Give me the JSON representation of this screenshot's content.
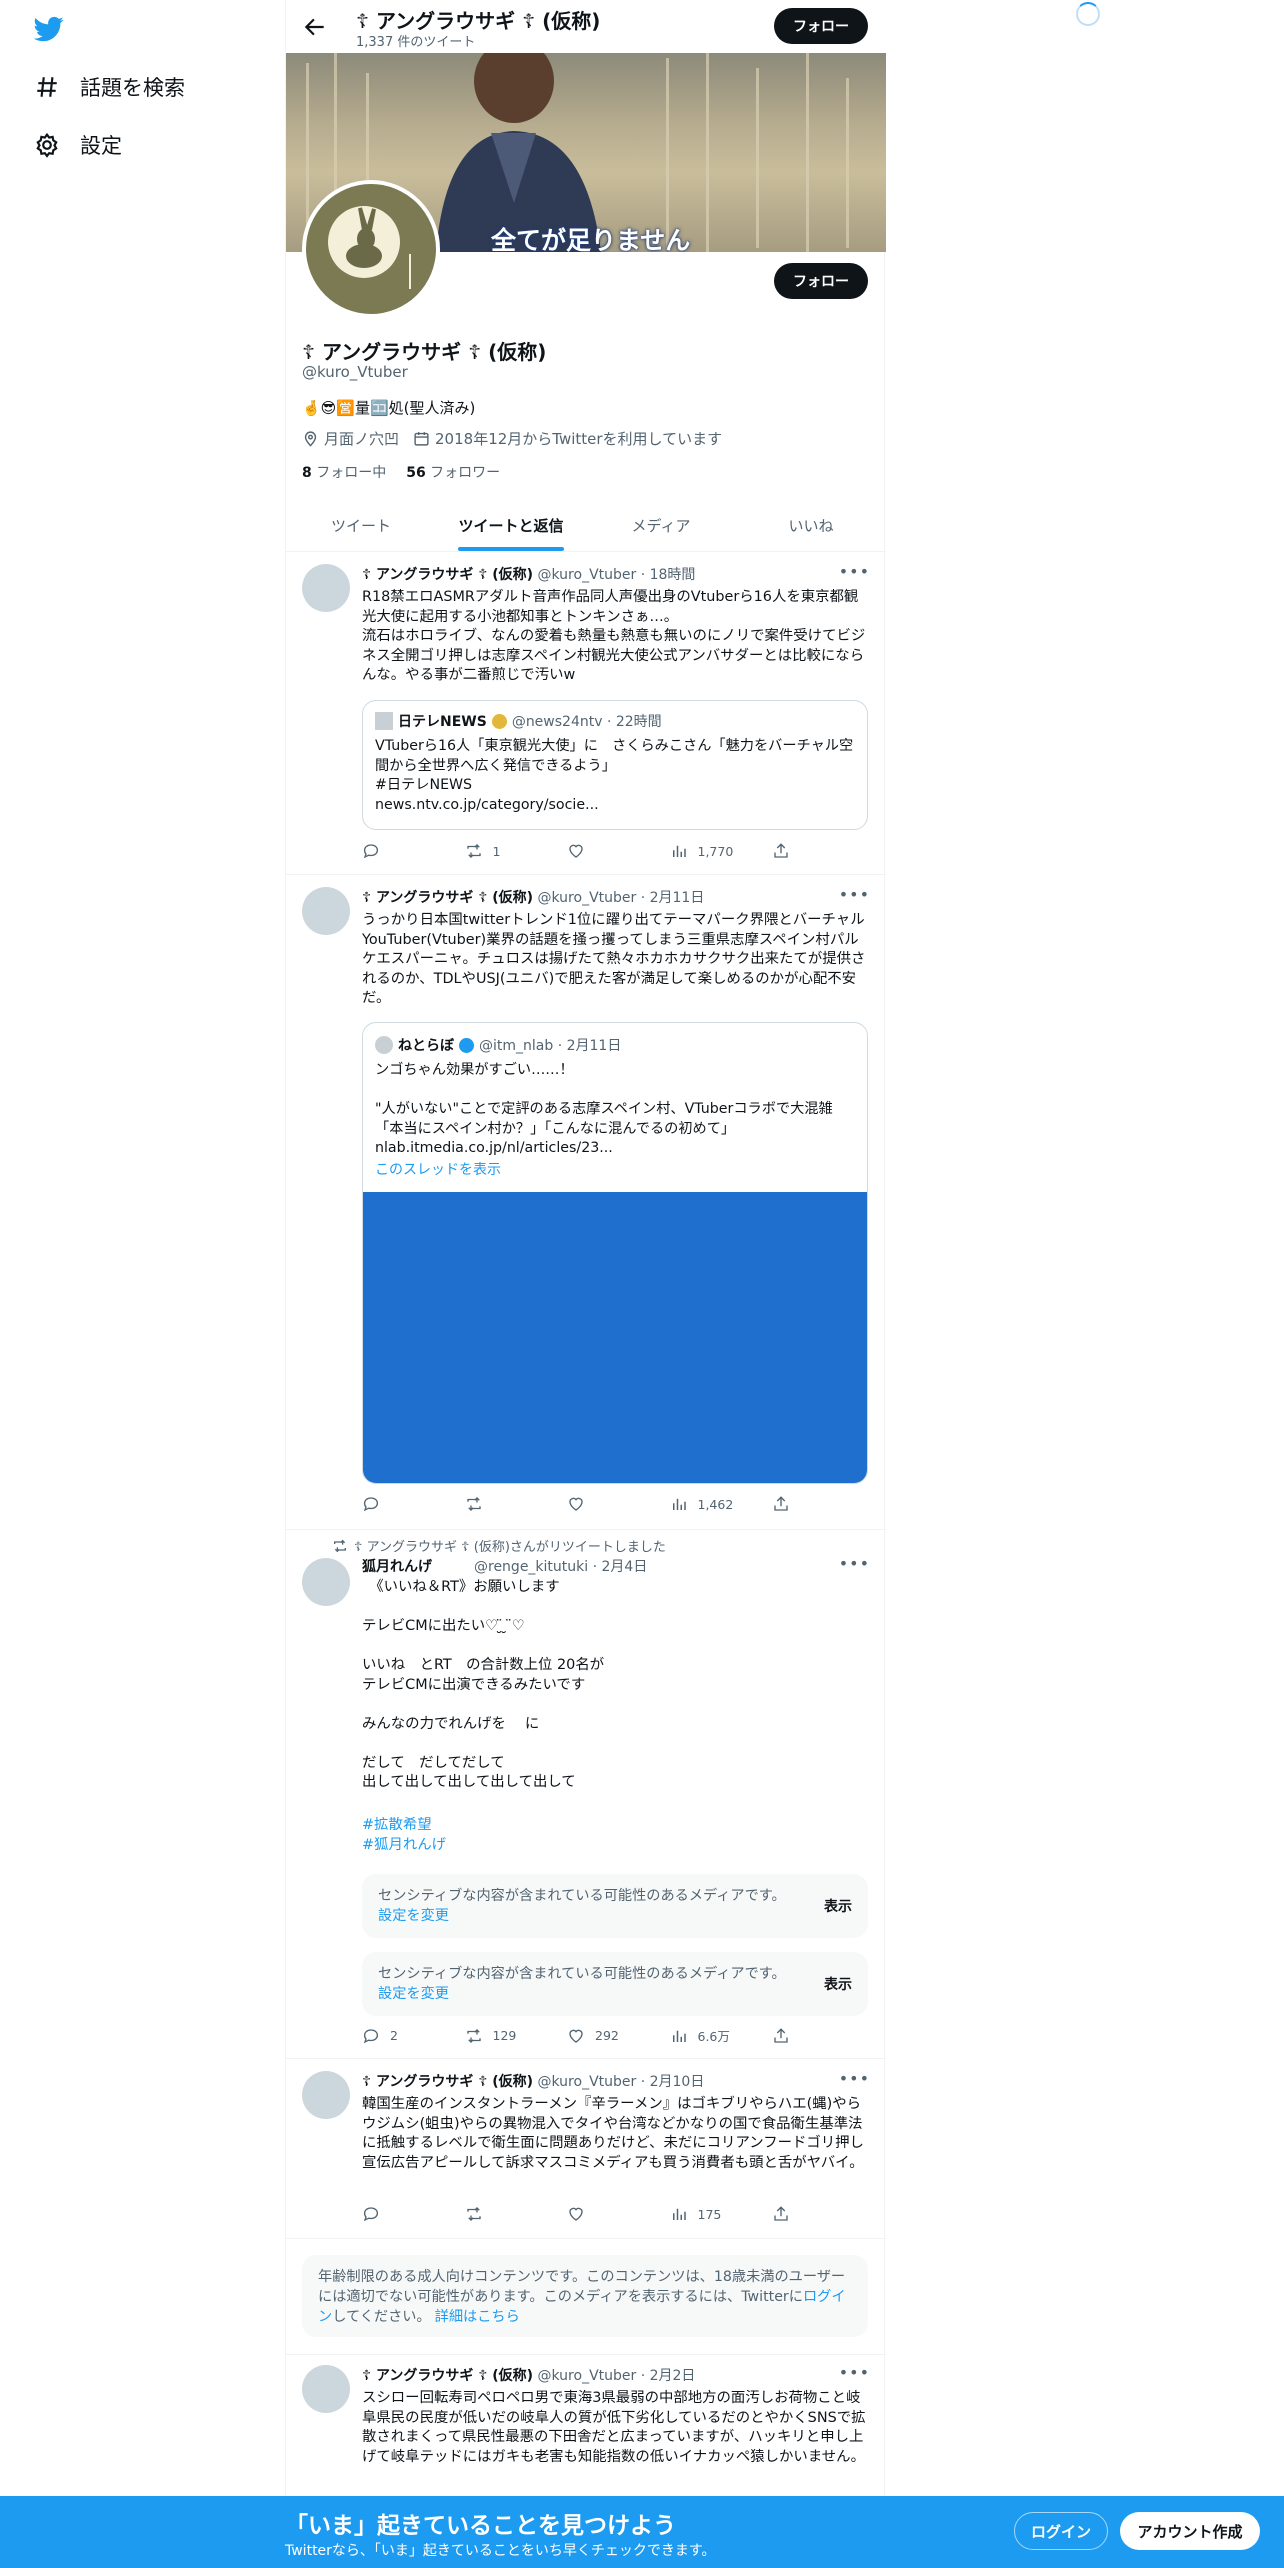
{
  "nav": {
    "explore": "話題を検索",
    "settings": "設定"
  },
  "profile": {
    "name": "☦ アングラウサギ ☦ (仮称)",
    "tweet_count": "1,337 件のツイート",
    "follow": "フォロー",
    "banner_caption": "全てが足りません",
    "handle": "@kuro_Vtuber",
    "bio": "🤞😎🈺量🈁処(聖人済み)",
    "location": "月面ノ穴凹",
    "joined": "2018年12月からTwitterを利用しています",
    "following_count": "8",
    "following_label": "フォロー中",
    "followers_count": "56",
    "followers_label": "フォロワー"
  },
  "tabs": [
    "ツイート",
    "ツイートと返信",
    "メディア",
    "いいね"
  ],
  "tweets": [
    {
      "name": "☦ アングラウサギ ☦ (仮称)",
      "handle": "@kuro_Vtuber · 18時間",
      "text": "R18禁エロASMRアダルト音声作品同人声優出身のVtuberら16人を東京都観光大使に起用する小池都知事とトンキンさぁ…。\n流石はホロライブ、なんの愛着も熱量も熱意も無いのにノリで案件受けてビジネス全開ゴリ押しは志摩スペイン村観光大使公式アンバサダーとは比較にならんな。やる事が二番煎じで汚いw",
      "quote": {
        "name": "日テレNEWS",
        "handle": "@news24ntv · 22時間",
        "text": "VTuberら16人「東京観光大使」に　さくらみこさん「魅力をバーチャル空間から全世界へ広く発信できるよう」\n#日テレNEWS\nnews.ntv.co.jp/category/socie..."
      },
      "stats": {
        "reply": "",
        "retweet": "1",
        "like": "",
        "views": "1,770"
      }
    },
    {
      "name": "☦ アングラウサギ ☦ (仮称)",
      "handle": "@kuro_Vtuber · 2月11日",
      "text": "うっかり日本国twitterトレンド1位に躍り出てテーマパーク界隈とバーチャルYouTuber(Vtuber)業界の話題を掻っ攫ってしまう三重県志摩スペイン村パルケエスパーニャ。チュロスは揚げたて熱々ホカホカサクサク出来たてが提供されるのか、TDLやUSJ(ユニバ)で肥えた客が満足して楽しめるのかが心配不安だ。",
      "quote": {
        "name": "ねとらぼ",
        "handle": "@itm_nlab · 2月11日",
        "text": "ンゴちゃん効果がすごい……！\n\n\"人がいない\"ことで定評のある志摩スペイン村、VTuberコラボで大混雑「本当にスペイン村か？」「こんなに混んでるの初めて」\nnlab.itmedia.co.jp/nl/articles/23...",
        "thread": "このスレッドを表示"
      },
      "stats": {
        "reply": "",
        "retweet": "",
        "like": "",
        "views": "1,462"
      }
    },
    {
      "retweeted_by": "☦ アングラウサギ ☦ (仮称)さんがリツイートしました",
      "name": "狐月れんげ",
      "handle": "@renge_kitutuki · 2月4日",
      "text": "　《いいね＆RT》お願いします\n\nテレビCMに出たい♡ ̮̈ ̮ ̈♡\n\nいいね　とRT　の合計数上位 20名が\nテレビCMに出演できるみたいです\n\nみんなの力でれんげを　 に\n\nだして　だしてだして\n出して出して出して出して出して",
      "hashtags": [
        "#拡散希望",
        "#狐月れんげ"
      ],
      "sensitive_text": "センシティブな内容が含まれている可能性のあるメディアです。",
      "sensitive_link": "設定を変更",
      "sensitive_btn": "表示",
      "stats": {
        "reply": "2",
        "retweet": "129",
        "like": "292",
        "views": "6.6万"
      }
    },
    {
      "name": "☦ アングラウサギ ☦ (仮称)",
      "handle": "@kuro_Vtuber · 2月10日",
      "text": "韓国生産のインスタントラーメン『辛ラーメン』はゴキブリやらハエ(蝿)やらウジムシ(蛆虫)やらの異物混入でタイや台湾などかなりの国で食品衛生基準法に抵触するレベルで衛生面に問題ありだけど、未だにコリアンフードゴリ押し宣伝広告アピールして訴求マスコミメディアも買う消費者も頭と舌がヤバイ。",
      "stats": {
        "reply": "",
        "retweet": "",
        "like": "",
        "views": "175"
      }
    },
    {
      "name": "☦ アングラウサギ ☦ (仮称)",
      "handle": "@kuro_Vtuber · 2月2日",
      "text": "スシロー回転寿司ペロペロ男で東海3県最弱の中部地方の面汚しお荷物こと岐阜県民の民度が低いだの岐阜人の質が低下劣化しているだのとやかくSNSで拡散されまくって県民性最悪の下田舎だと広まっていますが、ハッキリと申し上げて岐阜テッドにはガキも老害も知能指数の低いイナカッペ猿しかいません。"
    }
  ],
  "age_notice": {
    "text_before": "年齢制限のある成人向けコンテンツです。このコンテンツは、18歳未満のユーザーには適切でない可能性があります。このメディアを表示するには、Twitterに",
    "login": "ログイン",
    "text_mid": "してください。",
    "details": "詳細はこちら"
  },
  "bottom_bar": {
    "title": "「いま」起きていることを見つけよう",
    "subtitle": "Twitterなら、「いま」起きていることをいち早くチェックできます。",
    "login": "ログイン",
    "signup": "アカウント作成"
  },
  "colors": {
    "accent": "#1d9bf0",
    "text": "#0f1419",
    "muted": "#536471",
    "media_blue": "#1f6fcf"
  }
}
